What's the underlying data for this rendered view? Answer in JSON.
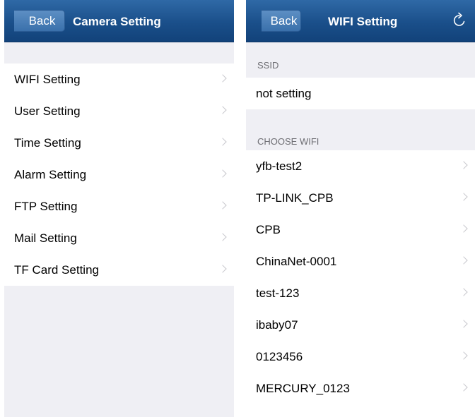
{
  "camera_screen": {
    "back_label": "Back",
    "title": "Camera Setting",
    "items": [
      {
        "label": "WIFI Setting"
      },
      {
        "label": "User Setting"
      },
      {
        "label": "Time Setting"
      },
      {
        "label": "Alarm Setting"
      },
      {
        "label": "FTP Setting"
      },
      {
        "label": "Mail Setting"
      },
      {
        "label": "TF Card Setting"
      }
    ]
  },
  "wifi_screen": {
    "back_label": "Back",
    "title": "WIFI Setting",
    "ssid_header": "SSID",
    "ssid_value": "not setting",
    "choose_header": "CHOOSE WIFI",
    "networks": [
      {
        "name": "yfb-test2"
      },
      {
        "name": "TP-LINK_CPB"
      },
      {
        "name": "CPB"
      },
      {
        "name": "ChinaNet-0001"
      },
      {
        "name": "test-123"
      },
      {
        "name": "ibaby07"
      },
      {
        "name": "0123456"
      },
      {
        "name": "MERCURY_0123"
      }
    ]
  },
  "colors": {
    "navbar": "#1a4f8a",
    "background": "#efeff4",
    "chevron": "#c7c7cc"
  },
  "icons": {
    "refresh": "refresh-icon",
    "disclosure": "chevron-right-icon"
  }
}
